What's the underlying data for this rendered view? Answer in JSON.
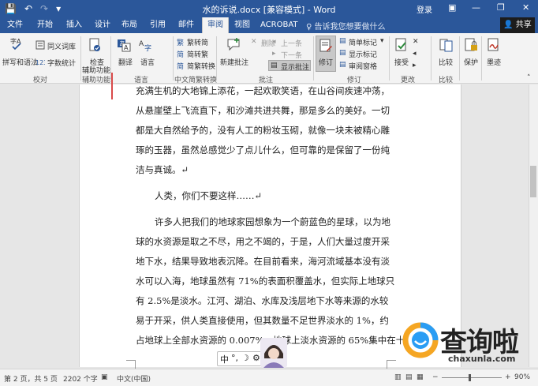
{
  "title_bar": {
    "document_title": "水的诉说.docx [兼容模式] - Word",
    "login_label": "登录",
    "qat": {
      "save_glyph": "💾",
      "undo_glyph": "↶",
      "redo_glyph": "↷",
      "customize_glyph": "▾"
    },
    "window": {
      "restore_glyph": "▣",
      "minimize_glyph": "—",
      "maximize_glyph": "❐",
      "close_glyph": "✕"
    }
  },
  "tabs": [
    "文件",
    "开始",
    "插入",
    "设计",
    "布局",
    "引用",
    "邮件",
    "审阅",
    "视图",
    "ACROBAT"
  ],
  "active_tab": "审阅",
  "tell_me": "♀ 告诉我您想要做什么",
  "share": {
    "label": "👤 共享"
  },
  "ribbon": {
    "proofing": {
      "spelling": "拼写和语法",
      "thesaurus": "同义词库",
      "word_count": "字数统计",
      "group": "校对"
    },
    "accessibility": {
      "check": "检查",
      "check2": "辅助功能",
      "group": "辅助功能"
    },
    "language": {
      "translate": "翻译",
      "language": "语言",
      "group": "语言"
    },
    "chinese_conversion": {
      "to_simplified": "繁转简",
      "to_traditional": "简转繁",
      "conversion": "简繁转换",
      "group": "中文简繁转换"
    },
    "comments": {
      "new": "新建批注",
      "delete": "删除",
      "previous": "上一条",
      "next": "下一条",
      "show": "显示批注",
      "group": "批注"
    },
    "tracking": {
      "track": "修订",
      "markup_mode": "简单标记",
      "show_markup": "显示标记",
      "review_pane": "审阅窗格",
      "group": "修订"
    },
    "changes": {
      "accept": "接受",
      "group": "更改"
    },
    "compare": {
      "compare": "比较",
      "group": "比较"
    },
    "protect": {
      "protect": "保护"
    },
    "ink": {
      "ink": "墨迹"
    }
  },
  "document": {
    "lines": [
      "充满生机的大地锦上添花，一起欢歌笑语，在山谷间疾速冲荡，",
      "从悬崖壁上飞流直下，和沙滩共进共舞，那是多么的美好。一切",
      "都是大自然给予的，没有人工的粉妆玉砌，就像一块未被精心雕",
      "琢的玉器，虽然总感觉少了点儿什么，但可靠的是保留了一份纯",
      "洁与真诚。↵",
      "人类，你们不要这样……↵",
      "许多人把我们的地球家园想象为一个蔚蓝色的星球，以为地",
      "球的水资源是取之不尽，用之不竭的，于是，人们大量过度开采",
      "地下水，结果导致地表沉降。在目前看来，海河流域基本没有淡",
      "水可以入海，地球虽然有 71%的表面积覆盖水，但实际上地球只",
      "有 2.5%是淡水。江河、湖泊、水库及浅层地下水等来源的水较",
      "易于开采，供人类直接使用，但其数量不足世界淡水的 1%，约",
      "占地球上全部水资源的 0.007%。地球上淡水资源的 65%集中在十"
    ]
  },
  "ime_bar": {
    "lang": "中",
    "punct": "°,",
    "mode": "☽",
    "settings": "⚙"
  },
  "status_bar": {
    "page": "第 2 页，共 5 页",
    "words": "2202 个字",
    "language": "中文(中国)",
    "zoom_minus": "−",
    "zoom_plus": "+",
    "zoom_level": "90%",
    "zoom_fraction": 0.45
  },
  "watermark": {
    "title": "查询啦",
    "url": "chaxunla.com"
  },
  "colors": {
    "word_blue": "#2b579a",
    "change_bar": "#d94a4a"
  }
}
